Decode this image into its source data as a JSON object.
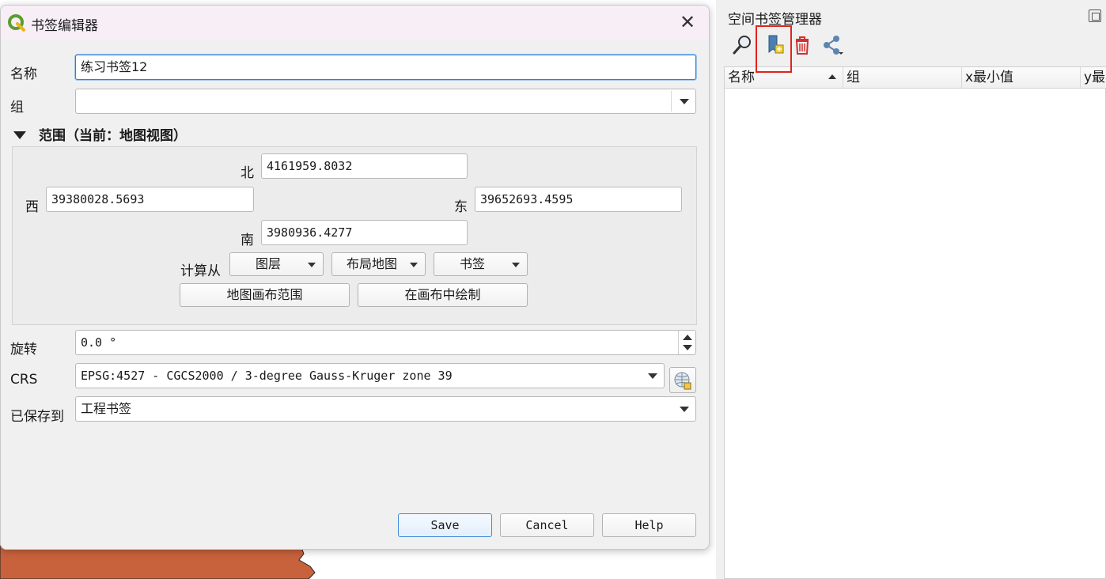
{
  "dialog": {
    "title": "书签编辑器",
    "name_label": "名称",
    "name_value": "练习书签12",
    "group_label": "组",
    "group_value": "",
    "extent_header": "范围（当前：地图视图）",
    "north_label": "北",
    "north_value": "4161959.8032",
    "west_label": "西",
    "west_value": "39380028.5693",
    "east_label": "东",
    "east_value": "39652693.4595",
    "south_label": "南",
    "south_value": "3980936.4277",
    "calc_from_label": "计算从",
    "calc_buttons": [
      "图层",
      "布局地图",
      "书签"
    ],
    "canvas_extent_button": "地图画布范围",
    "draw_on_canvas_button": "在画布中绘制",
    "rotation_label": "旋转",
    "rotation_value": "0.0 °",
    "crs_label": "CRS",
    "crs_value": "EPSG:4527 - CGCS2000 / 3-degree Gauss-Kruger zone 39",
    "saved_to_label": "已保存到",
    "saved_to_value": "工程书签",
    "save_button": "Save",
    "cancel_button": "Cancel",
    "help_button": "Help"
  },
  "panel": {
    "title": "空间书签管理器",
    "columns": [
      "名称",
      "组",
      "x最小值",
      "y最小"
    ]
  },
  "colors": {
    "highlight": "#e2231a",
    "focus_border": "#2f7fd0",
    "map_fill": "#c8623c"
  },
  "icons": [
    "qgis-logo-icon",
    "close-icon",
    "zoom-to-bookmark-icon",
    "add-bookmark-icon",
    "delete-icon",
    "share-icon",
    "crs-selector-icon"
  ]
}
